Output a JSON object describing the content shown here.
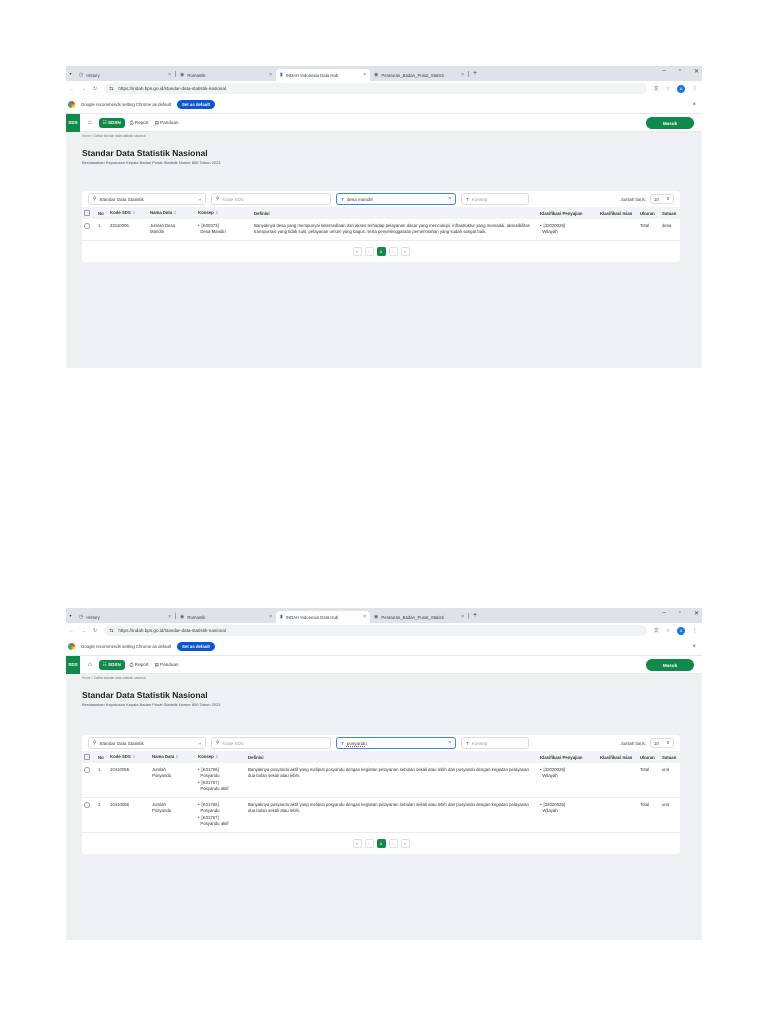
{
  "browser": {
    "tabs": [
      {
        "label": "History",
        "active": false
      },
      {
        "label": "Romantik",
        "active": false
      },
      {
        "label": "INDAH Indonesia Data Hub",
        "active": true
      },
      {
        "label": "Peraturan_Badan_Pusat_Statisti",
        "active": false
      }
    ],
    "url": "https://indah.bps.go.id/standar-data-statistik-nasional",
    "profile_initial": "A",
    "infobar_text": "Google recommends setting Chrome as default",
    "infobar_button": "Set as default"
  },
  "site": {
    "logo": "SDS",
    "nav": {
      "sdsn": "SDSN",
      "report": "Report",
      "panduan": "Panduan"
    },
    "login_button": "Masuk",
    "breadcrumb": "Home  >  Daftar standar data statistik nasional",
    "title": "Standar Data Statistik Nasional",
    "subtitle": "Berdasarkan Keputusan Kepala Badan Pusat Statistik Nomor 850 Tahun 2023"
  },
  "filters": {
    "type_selected": "Standar Data Statistik",
    "kode_placeholder": "Kode SDS",
    "konsep_placeholder": "Konsep",
    "rows_label": "Jumlah baris:",
    "rows_value": "10"
  },
  "columns": {
    "no": "No",
    "kode": "Kode SDS",
    "nama": "Nama Data",
    "konsep": "Konsep",
    "definisi": "Definisi",
    "penyajian": "Klasifikasi Penyajian",
    "isian": "Klasifikasi Isian",
    "ukuran": "Ukuran",
    "satuan": "Satuan"
  },
  "screen1": {
    "search_text": "desa mandiri",
    "rows": [
      {
        "no": "1",
        "kode": "33110006",
        "nama_line1": "Jumlah Desa",
        "nama_line2": "Mandiri",
        "konsep_code": "[K00373]",
        "konsep_name": "Desa Mandiri",
        "definisi": "Banyaknya desa yang mempunyai ketersediaan dan akses terhadap pelayanan dasar yang mencukupi, infrastruktur yang memadai, aksesibilitas transportasi yang tidak sulit, pelayanan umum yang bagus, serta penyelenggaraan pemerintahan yang sudah sangat baik.",
        "penyajian_code": "[32020026]",
        "penyajian_name": "Wilayah",
        "ukuran": "Total",
        "satuan": "desa"
      }
    ]
  },
  "screen2": {
    "search_text": "posyandu",
    "rows": [
      {
        "no": "1",
        "kode": "10410055",
        "nama_line1": "Jumlah",
        "nama_line2": "Posyandu",
        "konsep1_code": "[K01766]",
        "konsep1_name": "Posyandu",
        "konsep2_code": "[K01767]",
        "konsep2_name": "Posyandu aktif",
        "definisi": "Banyaknya posyandu aktif yang meliputi posyandu dengan kegiatan pelayanan sebulan sekali atau lebih dan posyandu dengan kegiatan pelayanan dua bulan sekali atau lebih.",
        "penyajian_code": "[32020026]",
        "penyajian_name": "Wilayah",
        "ukuran": "Total",
        "satuan": "unit"
      },
      {
        "no": "2",
        "kode": "10410056",
        "nama_line1": "Jumlah",
        "nama_line2": "Posyandu",
        "konsep1_code": "[K01766]",
        "konsep1_name": "Posyandu",
        "konsep2_code": "[K01767]",
        "konsep2_name": "Posyandu aktif",
        "definisi": "Banyaknya posyandu aktif yang meliputi posyandu dengan kegiatan pelayanan sebulan sekali atau lebih dan posyandu dengan kegiatan pelayanan dua bulan sekali atau lebih.",
        "penyajian_code": "[32020026]",
        "penyajian_name": "Wilayah",
        "ukuran": "Total",
        "satuan": "unit"
      }
    ]
  },
  "pagination": {
    "first": "«",
    "prev": "‹",
    "current": "1",
    "next": "›",
    "last": "»"
  },
  "colors": {
    "brand_green": "#0f8a4b",
    "chrome_blue": "#0b57d0",
    "tab_strip": "#dee3ea"
  }
}
